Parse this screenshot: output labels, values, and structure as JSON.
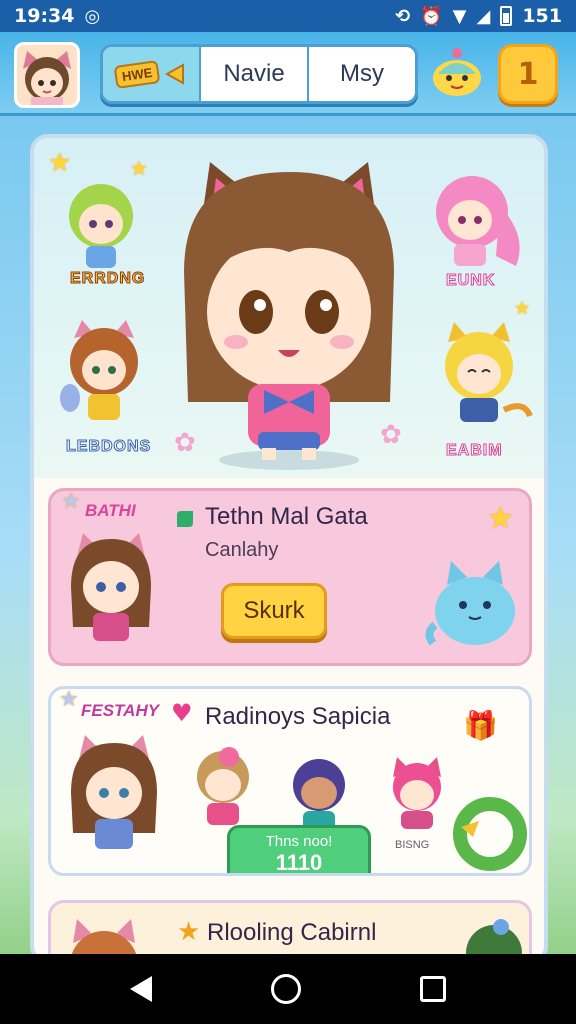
{
  "status_bar": {
    "time": "19:34",
    "battery_text": "151"
  },
  "header": {
    "home_badge": "HWE",
    "tab_left": "Navie",
    "tab_right": "Msy",
    "coin_count": "1"
  },
  "hero": {
    "labels": [
      "ERRDNG",
      "LEBDONS",
      "EUNK",
      "EABIM"
    ]
  },
  "cards": [
    {
      "tag": "BATHI",
      "title": "Tethn Mal Gata",
      "subtitle": "Canlahy",
      "button": "Skurk"
    },
    {
      "tag": "FESTAHY",
      "title": "Radinoys Sapicia",
      "button_line1": "Thns noo!",
      "button_line2": "1110",
      "small_label": "BISNG"
    },
    {
      "title": "Rlooling Cabirnl"
    }
  ],
  "colors": {
    "status_bar": "#1a5fa8",
    "accent_pink": "#d8459a",
    "button_yellow": "#ffd341",
    "button_green": "#4fcf7c"
  }
}
